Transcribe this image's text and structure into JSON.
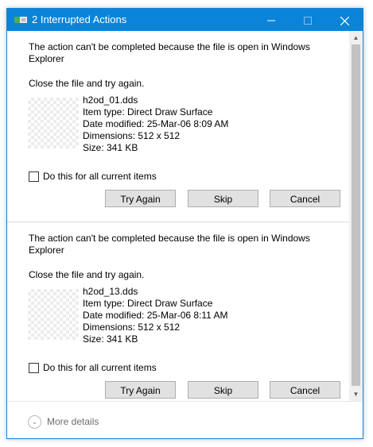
{
  "window": {
    "title": "2 Interrupted Actions",
    "accent_color": "#0a84d8",
    "icons": {
      "minimize": "minimize-icon",
      "maximize": "maximize-icon",
      "close": "close-icon"
    }
  },
  "items": [
    {
      "message": "The action can't be completed because the file is open in Windows Explorer",
      "hint": "Close the file and try again.",
      "file_name": "h2od_01.dds",
      "item_type": "Item type: Direct Draw Surface",
      "date_modified": "Date modified: 25-Mar-06 8:09 AM",
      "dimensions": "Dimensions: 512 x 512",
      "size": "Size: 341 KB",
      "checkbox_label": "Do this for all current items",
      "checkbox_checked": false,
      "buttons": {
        "try_again": "Try Again",
        "skip": "Skip",
        "cancel": "Cancel"
      }
    },
    {
      "message": "The action can't be completed because the file is open in Windows Explorer",
      "hint": "Close the file and try again.",
      "file_name": "h2od_13.dds",
      "item_type": "Item type: Direct Draw Surface",
      "date_modified": "Date modified: 25-Mar-06 8:11 AM",
      "dimensions": "Dimensions: 512 x 512",
      "size": "Size: 341 KB",
      "checkbox_label": "Do this for all current items",
      "checkbox_checked": false,
      "buttons": {
        "try_again": "Try Again",
        "skip": "Skip",
        "cancel": "Cancel"
      }
    }
  ],
  "footer": {
    "more_details_label": "More details",
    "icon": "chevron-down-icon"
  }
}
